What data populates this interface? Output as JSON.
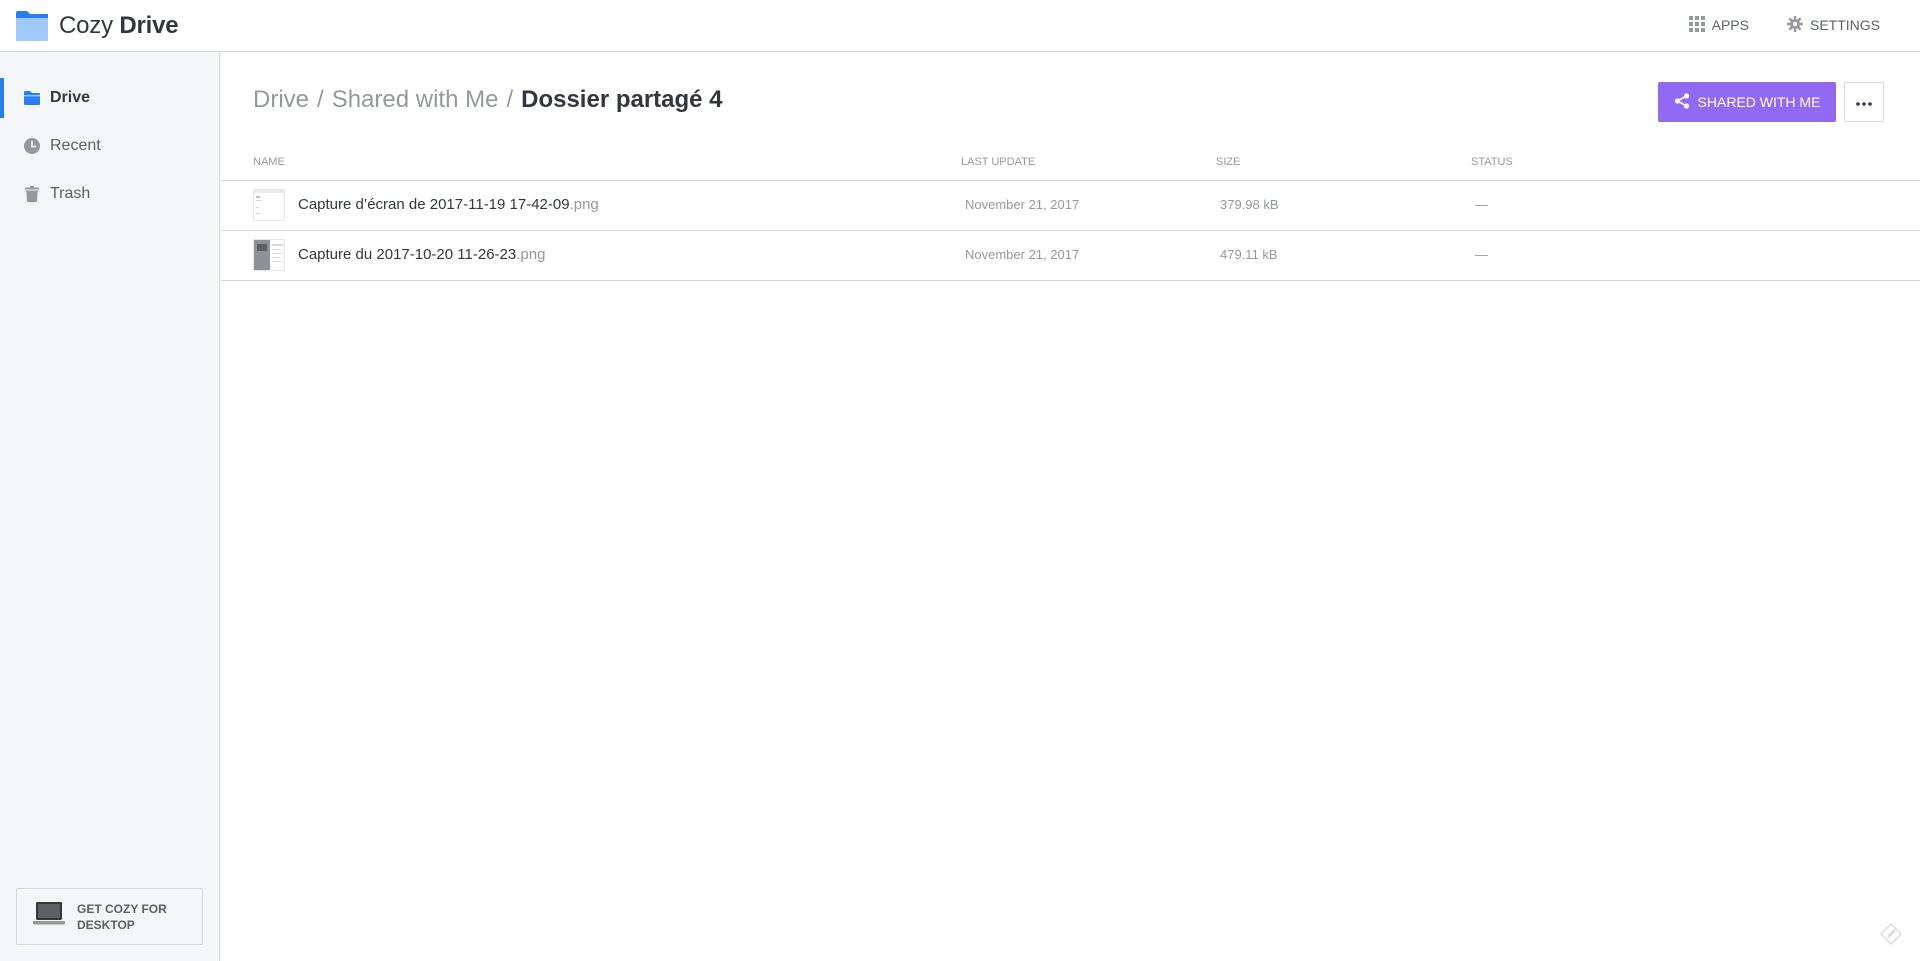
{
  "app": {
    "name_light": "Cozy",
    "name_bold": "Drive",
    "brand_color": "#297ef2"
  },
  "topbar": {
    "apps_label": "APPS",
    "settings_label": "SETTINGS",
    "apps_icon": "grid-icon",
    "settings_icon": "gear-icon"
  },
  "sidebar": {
    "items": [
      {
        "label": "Drive",
        "icon": "folder-icon",
        "active": true
      },
      {
        "label": "Recent",
        "icon": "clock-icon",
        "active": false
      },
      {
        "label": "Trash",
        "icon": "trash-icon",
        "active": false
      }
    ],
    "desktop_banner": "GET COZY FOR DESKTOP"
  },
  "breadcrumb": {
    "items": [
      "Drive",
      "Shared with Me"
    ],
    "separator": "/",
    "current": "Dossier partagé 4"
  },
  "toolbar": {
    "shared_label": "SHARED WITH ME",
    "shared_color": "#9169f2",
    "more_icon": "ellipsis-icon"
  },
  "table": {
    "columns": [
      "NAME",
      "LAST UPDATE",
      "SIZE",
      "STATUS"
    ],
    "rows": [
      {
        "name": "Capture d’écran de 2017-11-19 17-42-09",
        "ext": ".png",
        "updated": "November 21, 2017",
        "size": "379.98 kB",
        "status": "—"
      },
      {
        "name": "Capture du 2017-10-20 11-26-23",
        "ext": ".png",
        "updated": "November 21, 2017",
        "size": "479.11 kB",
        "status": "—"
      }
    ]
  }
}
